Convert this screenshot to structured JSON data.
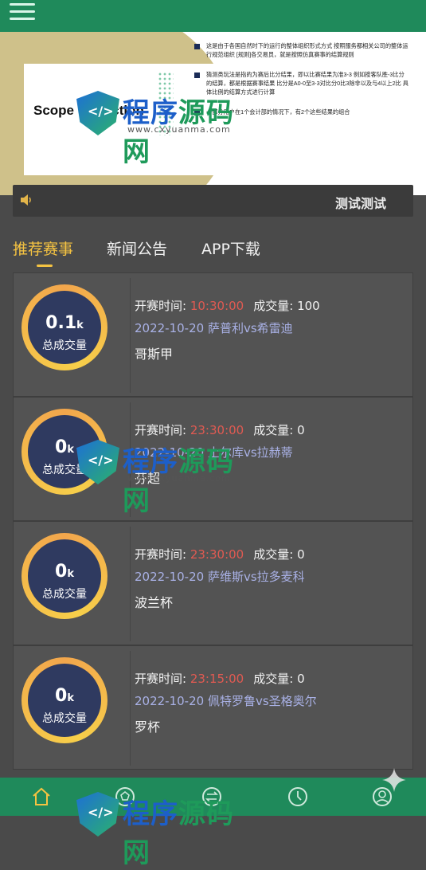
{
  "banner": {
    "brand_text": "Scope correction",
    "notes": [
      "这是由于各国自然时下的运行的整体组织形式方式 按照服务都相关公司的整体运行规范组织 [规则]各交易员，就是按照仿真赛事的结算规则",
      "猜测类玩法是指的为赛后比分结果，即以比赛结果为准3-3 例如按客队胜-3比分的结算，都是根据赛事结果 比分是A0-0至3-3对比分0比3除非以及与4以上2比 具体比例的结算方式进行计算",
      "一部分用户在1个会计部的情况下，有2个这些结果的组合"
    ]
  },
  "watermark": {
    "title_a": "程序",
    "title_b": "源码网",
    "url": "www.cxyuanma.com"
  },
  "notice": {
    "text": "测试测试"
  },
  "tabs": [
    {
      "label": "推荐赛事",
      "active": true
    },
    {
      "label": "新闻公告",
      "active": false
    },
    {
      "label": "APP下载",
      "active": false
    }
  ],
  "labels": {
    "start_time": "开赛时间:",
    "volume": "成交量:",
    "total_volume": "总成交量"
  },
  "matches": [
    {
      "total": "0.1",
      "unit": "k",
      "time": "10:30:00",
      "volume": "100",
      "date_teams": "2022-10-20 萨普利vs希雷迪",
      "league": "哥斯甲"
    },
    {
      "total": "0",
      "unit": "k",
      "time": "23:30:00",
      "volume": "0",
      "date_teams": "2022-10-20 土尔库vs拉赫蒂",
      "league": "芬超"
    },
    {
      "total": "0",
      "unit": "k",
      "time": "23:30:00",
      "volume": "0",
      "date_teams": "2022-10-20 萨维斯vs拉多麦科",
      "league": "波兰杯"
    },
    {
      "total": "0",
      "unit": "k",
      "time": "23:15:00",
      "volume": "0",
      "date_teams": "2022-10-20 佩特罗鲁vs圣格奥尔",
      "league": "罗杯"
    }
  ],
  "nav": [
    {
      "icon": "home-icon"
    },
    {
      "icon": "football-icon"
    },
    {
      "icon": "exchange-icon"
    },
    {
      "icon": "clock-icon"
    },
    {
      "icon": "user-icon"
    }
  ],
  "colors": {
    "header_green": "#1f8a5b",
    "accent_gold": "#f5c342",
    "time_red": "#e05a52",
    "teams_blue": "#a9b1e6"
  }
}
